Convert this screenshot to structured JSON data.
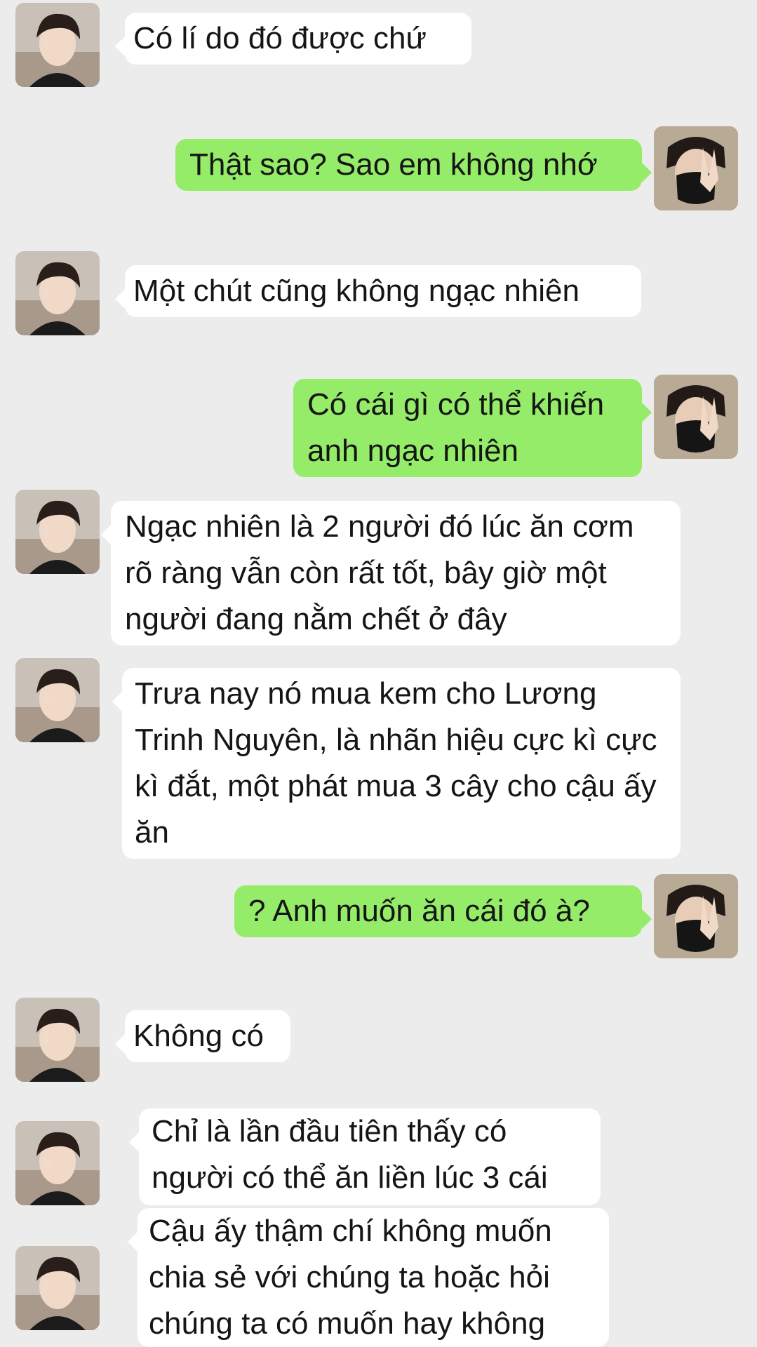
{
  "colors": {
    "background": "#ececec",
    "left_bubble": "#ffffff",
    "right_bubble": "#95ec69"
  },
  "avatars": {
    "left": "boy-with-v-sign-avatar",
    "right": "masked-boy-v-sign-avatar"
  },
  "messages": [
    {
      "side": "left",
      "text": "Có lí do đó được chứ"
    },
    {
      "side": "right",
      "text": "Thật sao? Sao em không nhớ"
    },
    {
      "side": "left",
      "text": "Một chút cũng không ngạc nhiên"
    },
    {
      "side": "right",
      "text": "Có cái gì có thể khiến anh ngạc nhiên"
    },
    {
      "side": "left",
      "text": "Ngạc nhiên là 2 người đó lúc ăn cơm rõ ràng vẫn còn rất tốt, bây giờ một người đang nằm chết ở đây"
    },
    {
      "side": "left",
      "text": "Trưa nay nó mua kem cho Lương Trinh Nguyên, là nhãn hiệu cực kì cực kì đắt, một phát mua 3 cây cho cậu ấy ăn"
    },
    {
      "side": "right",
      "text": "? Anh muốn ăn cái đó à?"
    },
    {
      "side": "left",
      "text": "Không có"
    },
    {
      "side": "left",
      "text": "Chỉ là lần đầu tiên thấy có người có thể ăn liền lúc 3 cái"
    },
    {
      "side": "left",
      "text": "Cậu ấy thậm chí không muốn chia sẻ với chúng ta hoặc hỏi chúng ta có muốn hay không"
    }
  ]
}
